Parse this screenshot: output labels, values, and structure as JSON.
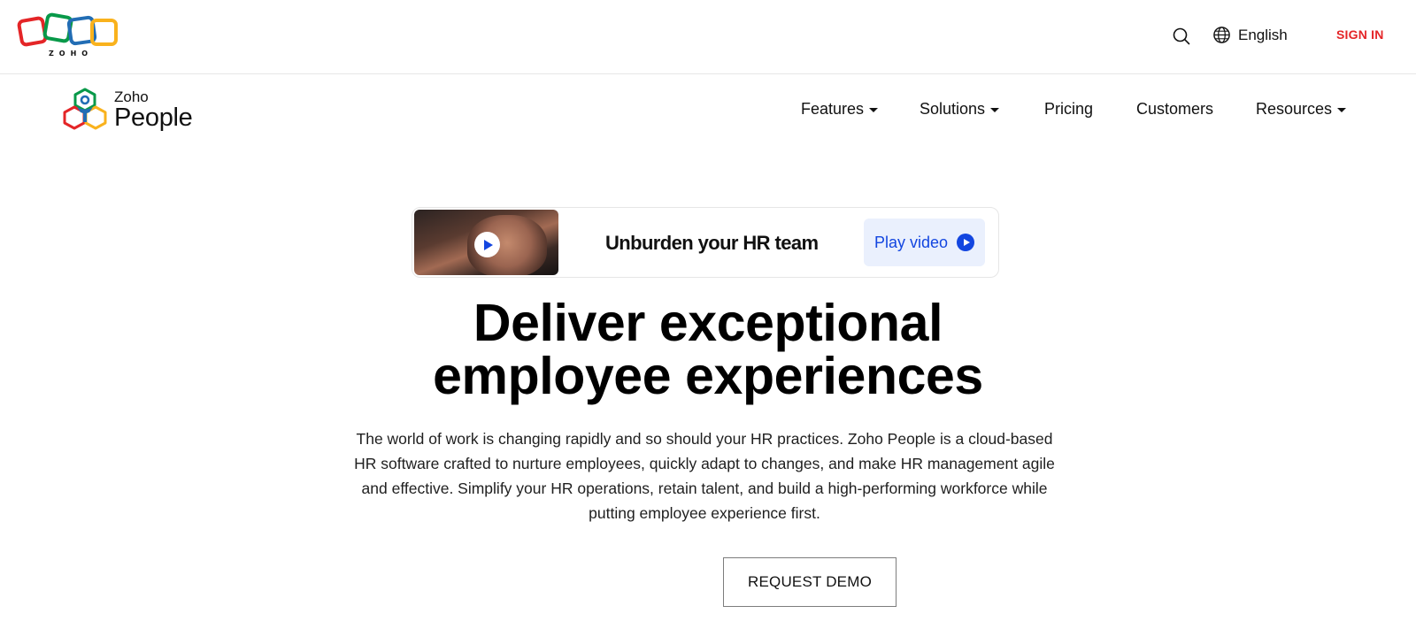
{
  "header": {
    "brand": "ZOHO",
    "language": "English",
    "sign_in": "SIGN IN"
  },
  "product": {
    "brand_small": "Zoho",
    "brand_name": "People"
  },
  "nav": {
    "items": [
      {
        "label": "Features",
        "has_dropdown": true
      },
      {
        "label": "Solutions",
        "has_dropdown": true
      },
      {
        "label": "Pricing",
        "has_dropdown": false
      },
      {
        "label": "Customers",
        "has_dropdown": false
      },
      {
        "label": "Resources",
        "has_dropdown": true
      }
    ]
  },
  "video_card": {
    "title": "Unburden your HR team",
    "play_label": "Play video"
  },
  "hero": {
    "headline_line1": "Deliver exceptional",
    "headline_line2": "employee experiences",
    "description": "The world of work is changing rapidly and so should your HR practices. Zoho People is a cloud-based HR software crafted to nurture employees, quickly adapt to changes, and make HR management agile and effective. Simplify your HR operations, retain talent, and build a high-performing workforce while putting employee experience first.",
    "cta": "REQUEST DEMO"
  },
  "colors": {
    "zoho_red": "#e42527",
    "zoho_green": "#089949",
    "zoho_blue": "#226db4",
    "zoho_yellow": "#f9b21d",
    "accent_blue": "#1346e0",
    "play_bg": "#eaf0fd"
  },
  "icons": [
    "zoho-logo-icon",
    "search-icon",
    "globe-icon",
    "people-logo-icon",
    "chevron-down-icon",
    "play-icon"
  ]
}
